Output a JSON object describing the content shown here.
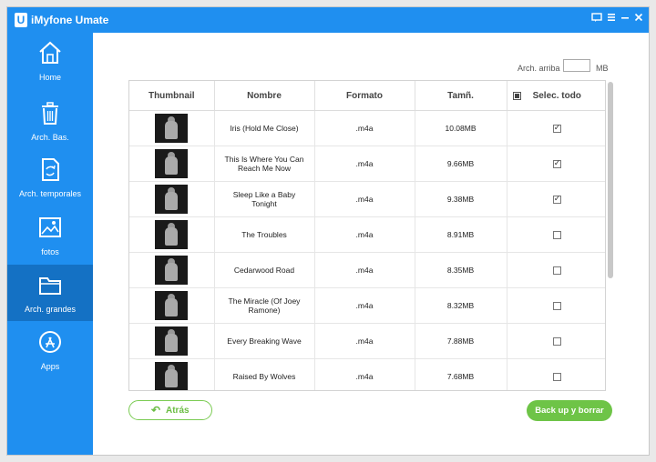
{
  "app": {
    "logo": "U",
    "title": "iMyfone Umate"
  },
  "window_controls": [
    "feedback-icon",
    "menu-icon",
    "minimize-icon",
    "close-icon"
  ],
  "sidebar": {
    "items": [
      {
        "label": "Home",
        "icon": "home-icon"
      },
      {
        "label": "Arch. Bas.",
        "icon": "trash-icon"
      },
      {
        "label": "Arch. temporales",
        "icon": "temp-files-icon"
      },
      {
        "label": "fotos",
        "icon": "photo-icon"
      },
      {
        "label": "Arch. grandes",
        "icon": "folder-icon",
        "active": true
      },
      {
        "label": "Apps",
        "icon": "app-store-icon"
      }
    ]
  },
  "filter": {
    "label": "Arch. arriba",
    "value": "",
    "unit": "MB"
  },
  "table": {
    "headers": {
      "thumbnail": "Thumbnail",
      "name": "Nombre",
      "format": "Formato",
      "size": "Tamñ.",
      "select_all": "Selec. todo"
    },
    "rows": [
      {
        "name": "Iris (Hold Me Close)",
        "format": ".m4a",
        "size": "10.08MB",
        "checked": true
      },
      {
        "name": "This Is Where You Can Reach Me Now",
        "format": ".m4a",
        "size": "9.66MB",
        "checked": true
      },
      {
        "name": "Sleep Like a Baby Tonight",
        "format": ".m4a",
        "size": "9.38MB",
        "checked": true
      },
      {
        "name": "The Troubles",
        "format": ".m4a",
        "size": "8.91MB",
        "checked": false
      },
      {
        "name": "Cedarwood Road",
        "format": ".m4a",
        "size": "8.35MB",
        "checked": false
      },
      {
        "name": "The Miracle (Of Joey Ramone)",
        "format": ".m4a",
        "size": "8.32MB",
        "checked": false
      },
      {
        "name": "Every Breaking Wave",
        "format": ".m4a",
        "size": "7.88MB",
        "checked": false
      },
      {
        "name": "Raised By Wolves",
        "format": ".m4a",
        "size": "7.68MB",
        "checked": false
      }
    ]
  },
  "buttons": {
    "back": "Atrás",
    "backup": "Back up y borrar"
  },
  "colors": {
    "accent": "#1f8ff0",
    "sidebar_active": "#1471c4",
    "green": "#6ec447"
  }
}
